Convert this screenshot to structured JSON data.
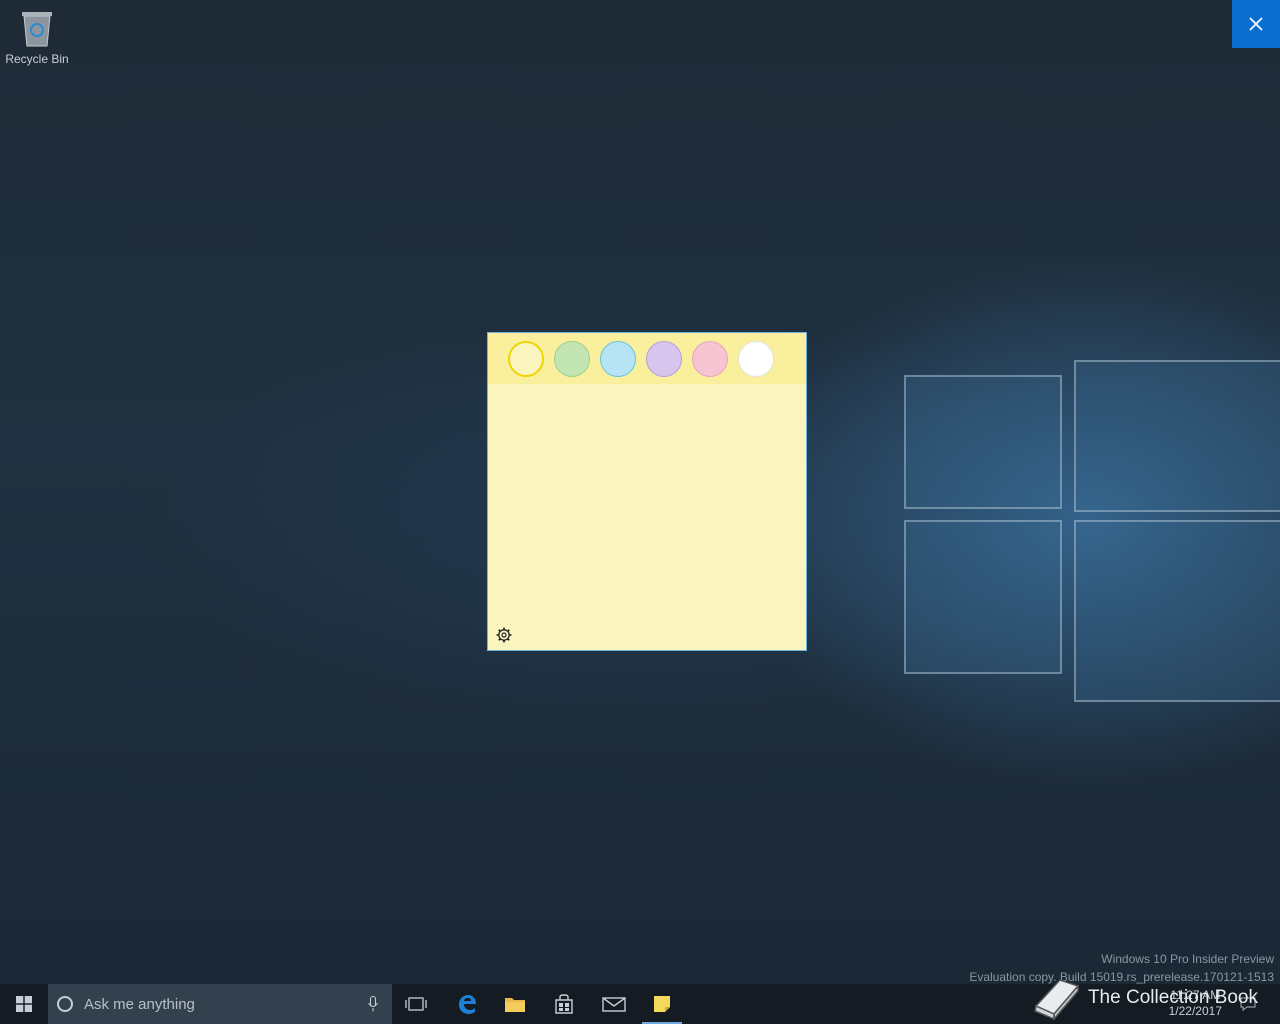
{
  "desktop": {
    "recycle_bin_label": "Recycle Bin"
  },
  "sticky_note": {
    "colors": [
      {
        "name": "yellow",
        "fill": "#faf5bf",
        "border": "#f2d400",
        "selected": true
      },
      {
        "name": "green",
        "fill": "#c3e5b4",
        "border": "#9bd18a",
        "selected": false
      },
      {
        "name": "blue",
        "fill": "#b7e4f4",
        "border": "#63c5e8",
        "selected": false
      },
      {
        "name": "purple",
        "fill": "#d8c5ee",
        "border": "#b9a0dc",
        "selected": false
      },
      {
        "name": "pink",
        "fill": "#f7c4d4",
        "border": "#eba3ba",
        "selected": false
      },
      {
        "name": "white",
        "fill": "#ffffff",
        "border": "#e3e3e3",
        "selected": false
      }
    ],
    "body_color": "#faf5bf",
    "bar_color": "#f9ef9c"
  },
  "watermark": {
    "line1": "Windows 10 Pro Insider Preview",
    "line2": "Evaluation copy. Build 15019.rs_prerelease.170121-1513"
  },
  "taskbar": {
    "search_placeholder": "Ask me anything",
    "clock_time": "11:27 AM",
    "clock_date": "1/22/2017",
    "icons": [
      "task-view-icon",
      "edge-icon",
      "file-explorer-icon",
      "store-icon",
      "mail-icon",
      "sticky-notes-icon"
    ]
  },
  "brand": {
    "text": "The Collection Book"
  },
  "colors": {
    "accent": "#0a6ed1"
  }
}
